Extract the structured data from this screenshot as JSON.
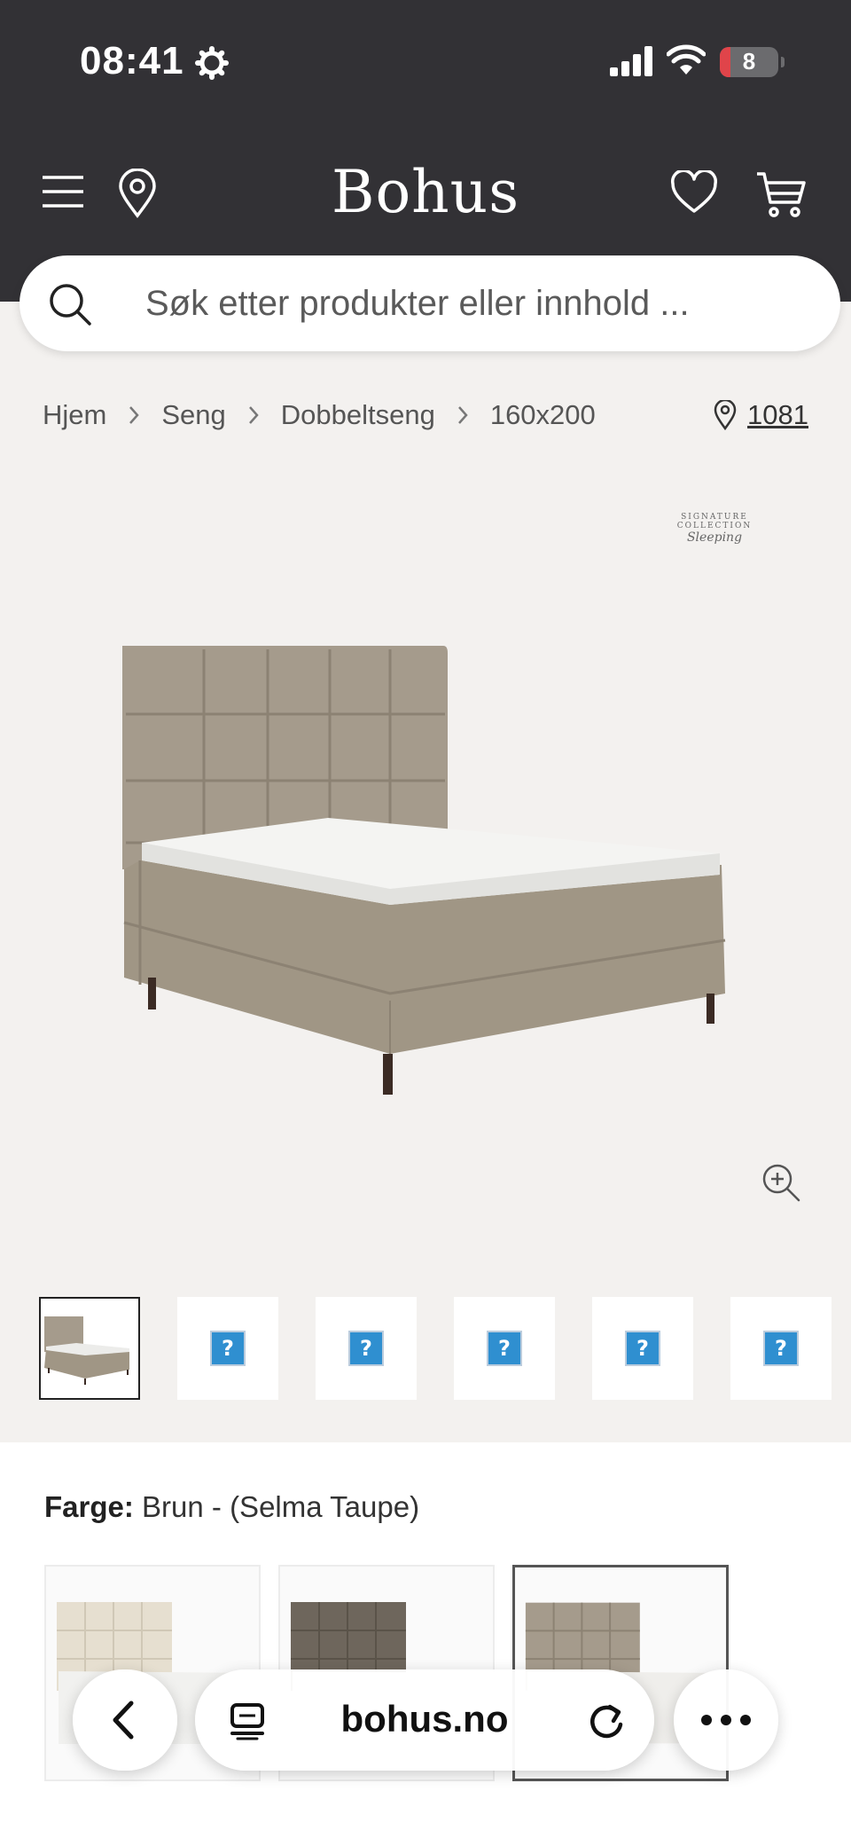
{
  "status_bar": {
    "time": "08:41",
    "battery": "8"
  },
  "header": {
    "logo": "Bohus",
    "search_placeholder": "Søk etter produkter eller innhold ..."
  },
  "breadcrumb": {
    "items": [
      "Hjem",
      "Seng",
      "Dobbeltseng",
      "160x200"
    ],
    "store": "1081"
  },
  "product": {
    "brand_logo_line1": "SIGNATURE COLLECTION",
    "brand_logo_line2": "Sleeping"
  },
  "thumbnails": {
    "count": 6,
    "active_index": 0
  },
  "color": {
    "label": "Farge:",
    "value": "Brun - (Selma Taupe)"
  },
  "browser": {
    "url": "bohus.no"
  },
  "colors": {
    "header_bg": "#323135",
    "page_bg": "#f3f1ef",
    "bed_fabric": "#a59b8c",
    "battery_low": "#e0444a"
  }
}
